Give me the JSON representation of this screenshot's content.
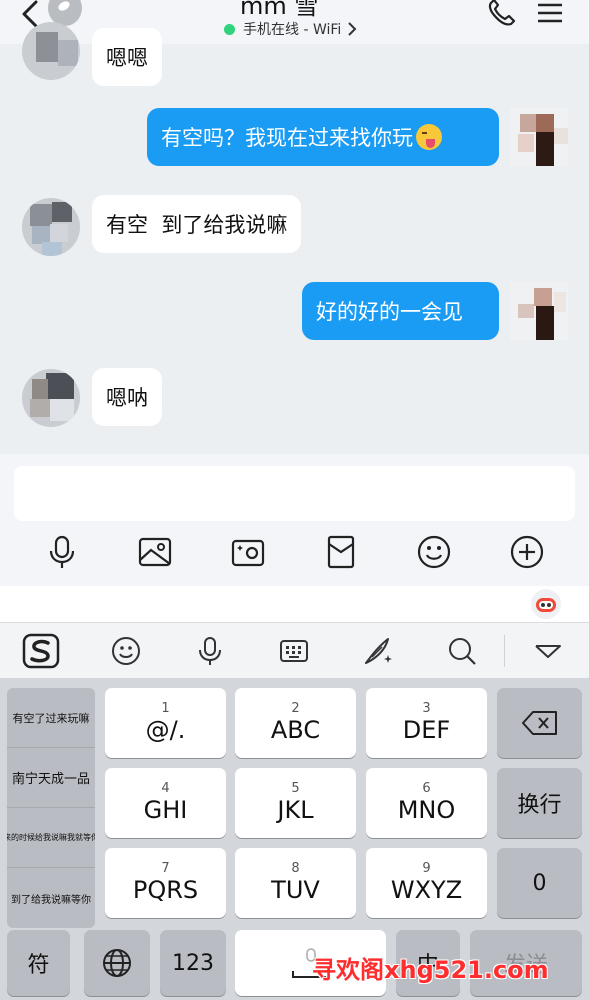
{
  "header": {
    "contact_name": "mm 雪",
    "status": "手机在线 - WiFi",
    "status_color": "#2ed37b"
  },
  "messages": [
    {
      "side": "in",
      "text": "嗯嗯"
    },
    {
      "side": "out",
      "text": "有空吗？我现在过来找你玩",
      "emoji": "winking-tongue-emoji"
    },
    {
      "side": "in",
      "text": "有空  到了给我说嘛"
    },
    {
      "side": "out",
      "text": "好的好的一会见"
    },
    {
      "side": "in",
      "text": "嗯呐"
    }
  ],
  "colors": {
    "outgoing_bubble": "#1a9cf5",
    "incoming_bubble": "#ffffff",
    "chat_background": "#eceff2"
  },
  "input": {
    "placeholder": "",
    "tools": [
      "microphone-icon",
      "image-icon",
      "camera-icon",
      "red-envelope-icon",
      "emoji-icon",
      "plus-icon"
    ]
  },
  "keyboard_toolbar": {
    "tools": [
      "sogou-logo-icon",
      "emoji-icon",
      "microphone-icon",
      "keyboard-icon",
      "handwriting-icon",
      "search-icon",
      "collapse-icon"
    ]
  },
  "keyboard": {
    "candidates": [
      "有空了过来玩嘛",
      "南宁天成一品",
      "来的时候给我说嘛我就等你",
      "到了给我说嘛等你"
    ],
    "keys": [
      {
        "num": "1",
        "label": "@/."
      },
      {
        "num": "2",
        "label": "ABC"
      },
      {
        "num": "3",
        "label": "DEF"
      },
      {
        "num": "4",
        "label": "GHI"
      },
      {
        "num": "5",
        "label": "JKL"
      },
      {
        "num": "6",
        "label": "MNO"
      },
      {
        "num": "7",
        "label": "PQRS"
      },
      {
        "num": "8",
        "label": "TUV"
      },
      {
        "num": "9",
        "label": "WXYZ"
      }
    ],
    "newline": "换行",
    "zero": "0",
    "symbol": "符",
    "number_mode": "123",
    "lang_switch": "中",
    "send": "发送"
  },
  "watermark": "寻欢阁xhg521.com"
}
